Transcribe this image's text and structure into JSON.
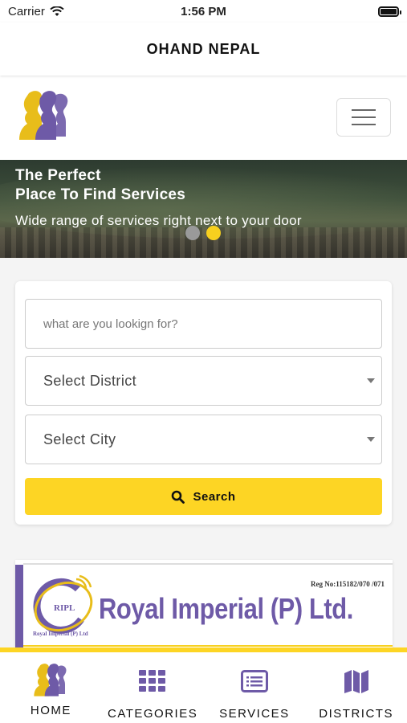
{
  "status_bar": {
    "carrier": "Carrier",
    "time": "1:56 PM"
  },
  "nav": {
    "title": "OHAND NEPAL"
  },
  "hero": {
    "title_line1": "The Perfect",
    "title_line2": "Place To Find Services",
    "subtitle": "Wide range of services right next to your door",
    "active_slide": 2,
    "slide_count": 2
  },
  "search": {
    "placeholder": "what are you lookign for?",
    "district_label": "Select District",
    "city_label": "Select City",
    "button_label": "Search"
  },
  "ad": {
    "reg_no": "Reg No:115182/070 /071",
    "company": "Royal Imperial (P) Ltd.",
    "logo_text": "RIPL",
    "logo_caption": "Royal Imperial (P) Ltd"
  },
  "tabs": [
    {
      "label": "HOME",
      "icon": "home-logo-icon"
    },
    {
      "label": "CATEGORIES",
      "icon": "grid-icon"
    },
    {
      "label": "SERVICES",
      "icon": "list-card-icon"
    },
    {
      "label": "DISTRICTS",
      "icon": "map-icon"
    }
  ],
  "colors": {
    "accent": "#fdd524",
    "brand_purple": "#6e5aa7",
    "dot_inactive": "#9a9a9a"
  }
}
